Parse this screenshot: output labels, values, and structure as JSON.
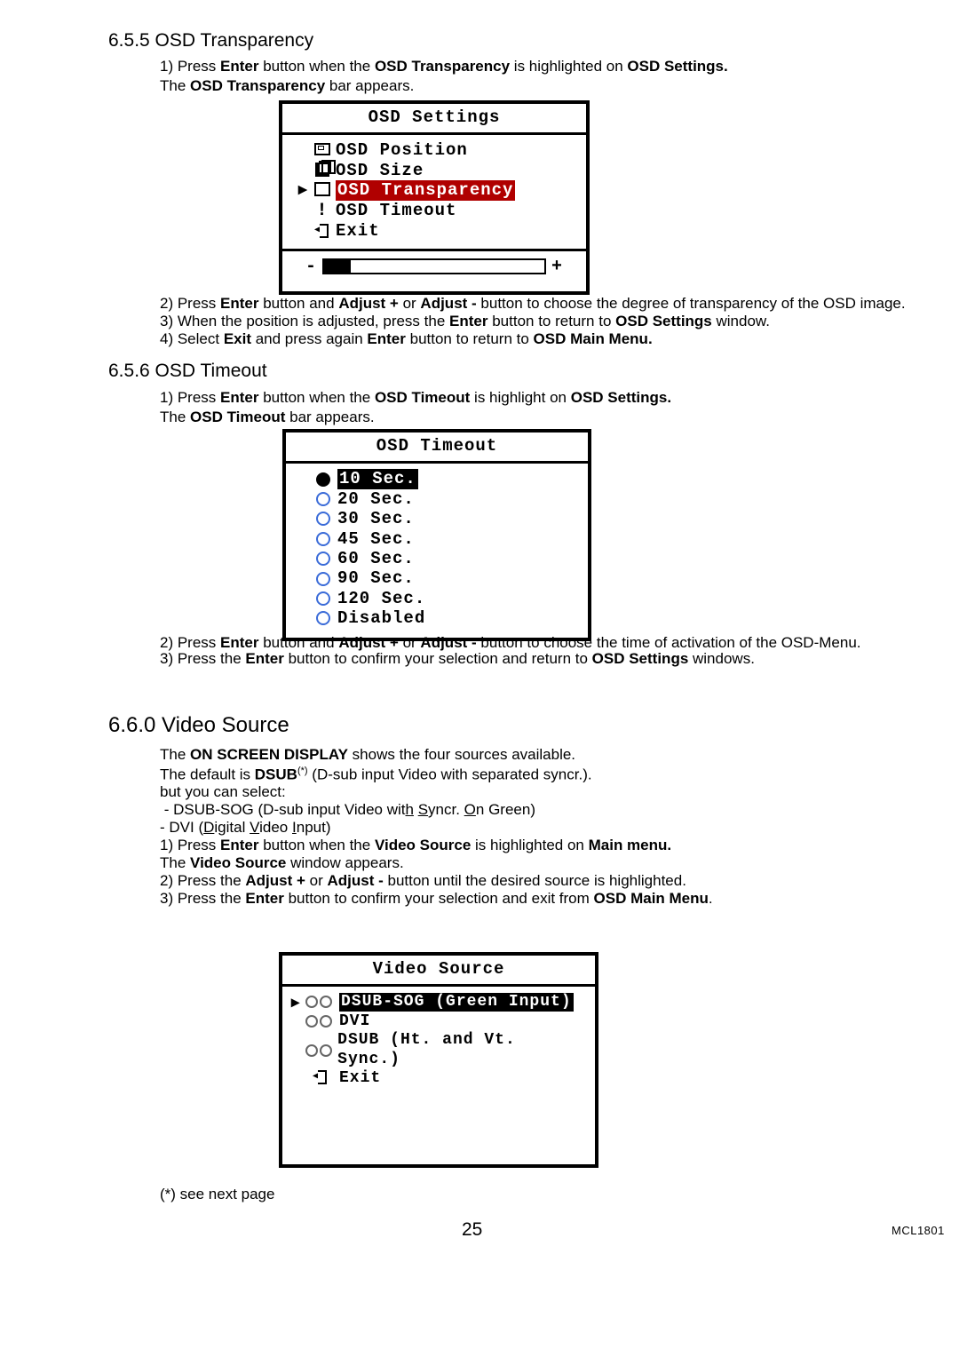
{
  "headings": {
    "h655": "6.5.5   OSD Transparency",
    "h656": "6.5.6   OSD Timeout",
    "h660": "6.6.0   Video Source"
  },
  "s655": {
    "l1a": "1) Press ",
    "l1b": "Enter",
    "l1c": " button when the ",
    "l1d": "OSD Transparency",
    "l1e": " is highlighted on ",
    "l1f": "OSD Settings.",
    "l2a": "The ",
    "l2b": "OSD Transparency",
    "l2c": " bar appears.",
    "l3a": "2) Press ",
    "l3b": "Enter",
    "l3c": " button and ",
    "l3d": "Adjust +",
    "l3e": " or ",
    "l3f": "Adjust -",
    "l3g": " button to choose the degree of transparency of the OSD image.",
    "l4a": "3) When the position is adjusted, press the ",
    "l4b": "Enter",
    "l4c": " button to return to ",
    "l4d": "OSD Settings",
    "l4e": " window.",
    "l5a": "4) Select ",
    "l5b": "Exit",
    "l5c": " and press again ",
    "l5d": "Enter",
    "l5e": " button to return to ",
    "l5f": "OSD Main Menu."
  },
  "s656": {
    "l1a": "1) Press ",
    "l1b": "Enter",
    "l1c": " button when the ",
    "l1d": "OSD Timeout",
    "l1e": " is highlight on ",
    "l1f": "OSD Settings.",
    "l2a": "The ",
    "l2b": "OSD Timeout",
    "l2c": " bar appears.",
    "l3a": "2) Press ",
    "l3b": "Enter",
    "l3c": " button and ",
    "l3d": "Adjust +",
    "l3e": " or ",
    "l3f": "Adjust -",
    "l3g": " button to choose the time of activation of the OSD-Menu.",
    "l4a": "3) Press the ",
    "l4b": "Enter",
    "l4c": " button to conﬁrm your selection and return to ",
    "l4d": "OSD Settings",
    "l4e": " windows."
  },
  "s660": {
    "l1a": "The ",
    "l1b": "ON SCREEN DISPLAY",
    "l1c": " shows the four sources available.",
    "l2a": " The default is ",
    "l2b": "DSUB",
    "l2ast": "(*)",
    "l2c": " (D-sub input Video with separated syncr.).",
    "l3": "but you can select:",
    "l4": " - DSUB-SOG (D-sub input Video with Syncr. On Green)",
    "l5a": " - DVI (",
    "l5d": "D",
    "l5e": "igital ",
    "l5v": "V",
    "l5f": "ideo ",
    "l5i": "I",
    "l5g": "nput)",
    "l6a": "1) Press ",
    "l6b": "Enter",
    "l6c": " button when the ",
    "l6d": "Video Source",
    "l6e": " is highlighted on ",
    "l6f": "Main menu.",
    "l7a": "The ",
    "l7b": "Video Source",
    "l7c": " window appears.",
    "l8a": "2) Press the ",
    "l8b": "Adjust +",
    "l8c": " or ",
    "l8d": "Adjust -",
    "l8e": " button until the desired source is highlighted.",
    "l9a": "3) Press the ",
    "l9b": "Enter",
    "l9c": " button to conﬁrm your selection and exit from ",
    "l9d": "OSD Main Menu",
    "l9e": "."
  },
  "osd1": {
    "title": "OSD Settings",
    "items": {
      "position": "OSD Position",
      "size": "OSD Size",
      "transparency": "OSD Transparency",
      "timeout": "OSD Timeout",
      "exit": "Exit"
    },
    "slider": {
      "minus": "-",
      "plus": "+"
    }
  },
  "osd2": {
    "title": "OSD Timeout",
    "options": [
      " 10 Sec.",
      " 20 Sec.",
      " 30 Sec.",
      " 45 Sec.",
      " 60 Sec.",
      " 90 Sec.",
      "120 Sec.",
      "Disabled"
    ]
  },
  "osd3": {
    "title": "Video Source",
    "items": {
      "dsub_sog": "DSUB-SOG (Green Input)",
      "dvi": "DVI",
      "dsub": "DSUB (Ht. and Vt. Sync.)",
      "exit": "Exit"
    }
  },
  "footer": {
    "footnote": "(*) see next page",
    "page": "25",
    "docid": "MCL1801"
  }
}
